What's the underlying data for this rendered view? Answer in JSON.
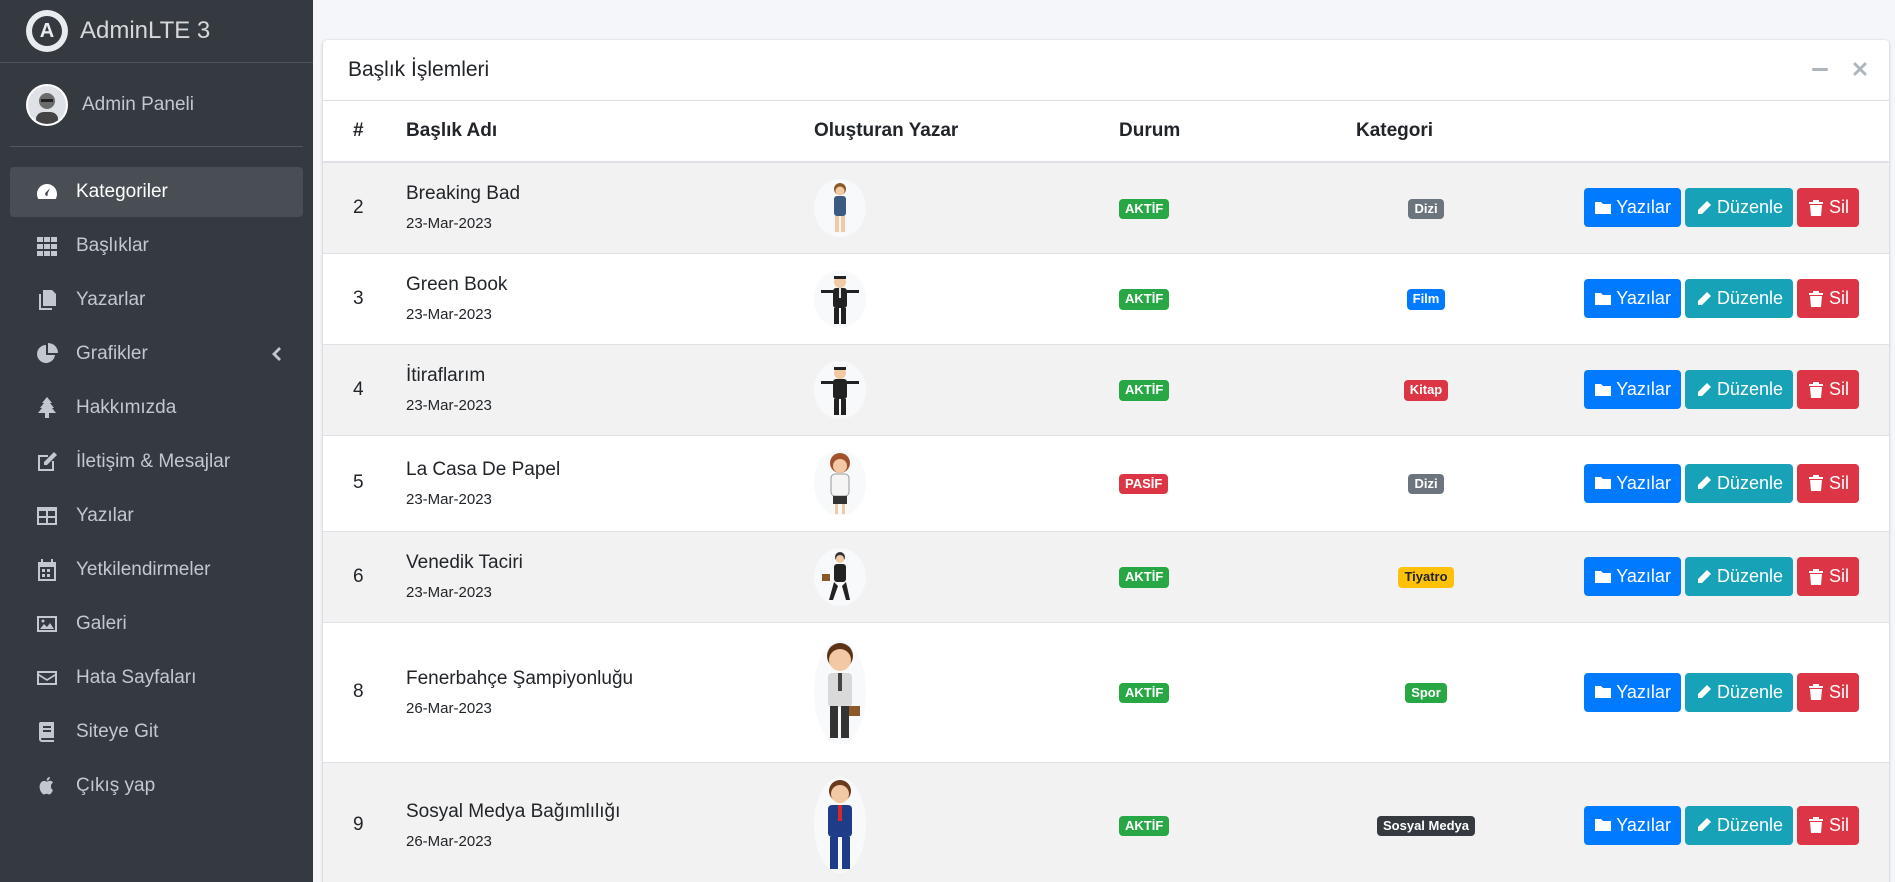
{
  "brand": {
    "name": "AdminLTE 3",
    "logo_letter": "A"
  },
  "user": {
    "name": "Admin Paneli"
  },
  "sidebar": {
    "items": [
      {
        "label": "Kategoriler",
        "icon": "tachometer-icon",
        "active": true
      },
      {
        "label": "Başlıklar",
        "icon": "grid-icon"
      },
      {
        "label": "Yazarlar",
        "icon": "copy-icon"
      },
      {
        "label": "Grafikler",
        "icon": "pie-chart-icon",
        "has_arrow": true
      },
      {
        "label": "Hakkımızda",
        "icon": "tree-icon"
      },
      {
        "label": "İletişim & Mesajlar",
        "icon": "edit-icon"
      },
      {
        "label": "Yazılar",
        "icon": "table-icon"
      },
      {
        "label": "Yetkilendirmeler",
        "icon": "calendar-icon"
      },
      {
        "label": "Galeri",
        "icon": "image-icon"
      },
      {
        "label": "Hata Sayfaları",
        "icon": "envelope-icon"
      },
      {
        "label": "Siteye Git",
        "icon": "book-icon"
      },
      {
        "label": "Çıkış yap",
        "icon": "apple-icon"
      }
    ]
  },
  "card": {
    "title": "Başlık İşlemleri"
  },
  "table": {
    "headers": {
      "id": "#",
      "title": "Başlık Adı",
      "author": "Oluşturan Yazar",
      "status": "Durum",
      "category": "Kategori"
    },
    "button_labels": {
      "posts": "Yazılar",
      "edit": "Düzenle",
      "delete": "Sil"
    },
    "rows": [
      {
        "id": "2",
        "title": "Breaking Bad",
        "date": "23-Mar-2023",
        "status": "AKTİF",
        "category": "Dizi"
      },
      {
        "id": "3",
        "title": "Green Book",
        "date": "23-Mar-2023",
        "status": "AKTİF",
        "category": "Film"
      },
      {
        "id": "4",
        "title": "İtiraflarım",
        "date": "23-Mar-2023",
        "status": "AKTİF",
        "category": "Kitap"
      },
      {
        "id": "5",
        "title": "La Casa De Papel",
        "date": "23-Mar-2023",
        "status": "PASİF",
        "category": "Dizi"
      },
      {
        "id": "6",
        "title": "Venedik Taciri",
        "date": "23-Mar-2023",
        "status": "AKTİF",
        "category": "Tiyatro"
      },
      {
        "id": "8",
        "title": "Fenerbahçe Şampiyonluğu",
        "date": "26-Mar-2023",
        "status": "AKTİF",
        "category": "Spor"
      },
      {
        "id": "9",
        "title": "Sosyal Medya Bağımlılığı",
        "date": "26-Mar-2023",
        "status": "AKTİF",
        "category": "Sosyal Medya"
      }
    ]
  },
  "colors": {
    "status": {
      "AKTİF": "#28a745",
      "PASİF": "#dc3545"
    },
    "category": {
      "Dizi": "#6c757d",
      "Film": "#007bff",
      "Kitap": "#dc3545",
      "Tiyatro": "#ffc107",
      "Spor": "#28a745",
      "Sosyal Medya": "#343a40"
    }
  }
}
